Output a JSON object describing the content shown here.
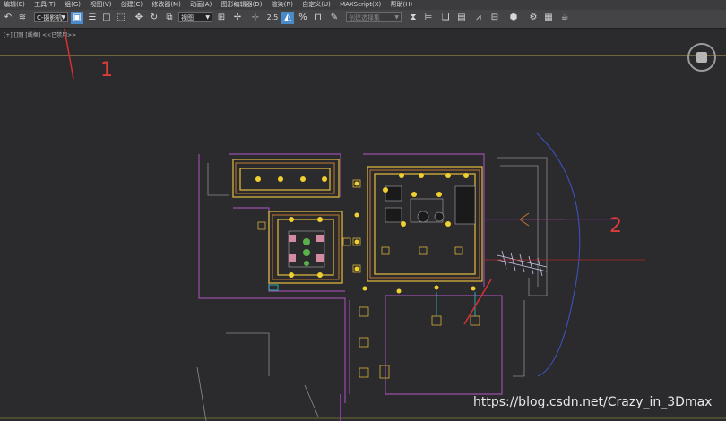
{
  "menu": [
    "编辑(E)",
    "工具(T)",
    "组(G)",
    "视图(V)",
    "创建(C)",
    "修改器(M)",
    "动画(A)",
    "图形编辑器(D)",
    "渲染(R)",
    "自定义(U)",
    "MAXScript(X)",
    "帮助(H)"
  ],
  "toolbar": {
    "selection_set_dropdown": "C-摄影机",
    "reference_coord_dropdown": "视图",
    "named_selection_dropdown": "创建选择集",
    "snap_label": "2.5",
    "percent_snap_label": "%",
    "colors": {
      "accent": "#4a8ac8"
    }
  },
  "viewport_label": {
    "plus": "[+]",
    "view": "[顶]",
    "mode": "[线框]",
    "tag": "<<已禁用>>"
  },
  "annotations": {
    "a1": "1",
    "a2": "2"
  },
  "watermark": "https://blog.csdn.net/Crazy_in_3Dmax",
  "icons": [
    "undo-icon",
    "redo-icon",
    "select-object-icon",
    "select-by-name-icon",
    "rect-region-icon",
    "window-crossing-icon",
    "move-icon",
    "rotate-icon",
    "scale-icon",
    "pivot-icon",
    "select-manipulate-icon",
    "snap-toggle-icon",
    "angle-snap-icon",
    "percent-snap-icon",
    "spinner-snap-icon",
    "mirror-icon",
    "align-icon",
    "layer-manager-icon",
    "ribbon-icon",
    "curve-editor-icon",
    "schematic-icon",
    "material-editor-icon",
    "render-setup-icon",
    "render-frame-icon",
    "render-icon",
    "teapot-icon"
  ]
}
